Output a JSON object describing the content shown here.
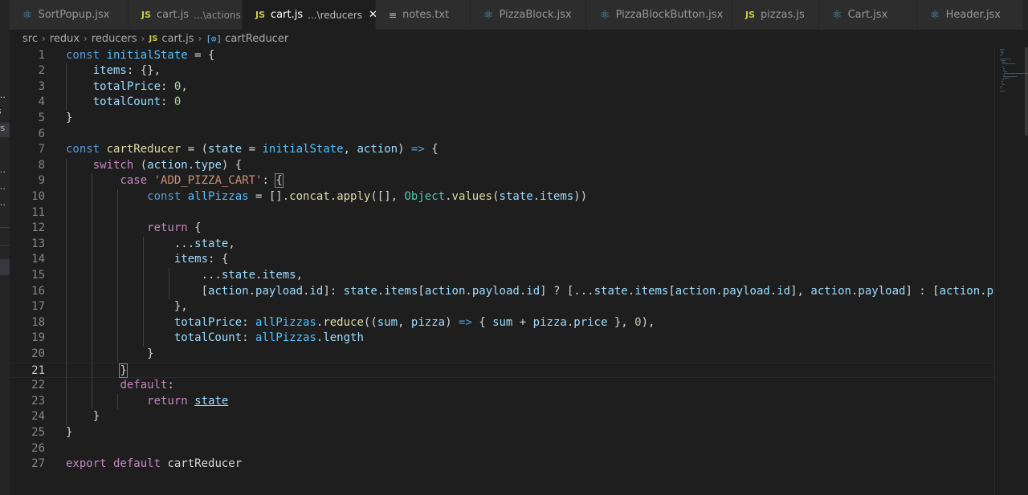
{
  "tabs": [
    {
      "icon": "react",
      "label": "SortPopup.jsx",
      "desc": "",
      "active": false
    },
    {
      "icon": "js",
      "label": "cart.js",
      "desc": "...\\actions",
      "active": false
    },
    {
      "icon": "js",
      "label": "cart.js",
      "desc": "...\\reducers",
      "active": true
    },
    {
      "icon": "txt",
      "label": "notes.txt",
      "desc": "",
      "active": false
    },
    {
      "icon": "react",
      "label": "PizzaBlock.jsx",
      "desc": "",
      "active": false
    },
    {
      "icon": "react",
      "label": "PizzaBlockButton.jsx",
      "desc": "",
      "active": false
    },
    {
      "icon": "js",
      "label": "pizzas.js",
      "desc": "",
      "active": false
    },
    {
      "icon": "react",
      "label": "Cart.jsx",
      "desc": "",
      "active": false
    },
    {
      "icon": "react",
      "label": "Header.jsx",
      "desc": "",
      "active": false
    }
  ],
  "tab_close": "✕",
  "icon_glyphs": {
    "react": "⚛",
    "js": "JS",
    "txt": "≡"
  },
  "breadcrumb": {
    "parts": [
      "src",
      "redux",
      "reducers"
    ],
    "file_icon": "JS",
    "file": "cart.js",
    "symbol_icon": "[⊙]",
    "symbol": "cartReducer"
  },
  "sidebar_fragments": [
    "…",
    "s",
    "rs",
    "…",
    "…",
    "…"
  ],
  "editor": {
    "current_line": 21,
    "lines": [
      [
        [
          "kw",
          "const "
        ],
        [
          "cn",
          "initialState"
        ],
        [
          "pn",
          " = {"
        ]
      ],
      [
        [
          "pn",
          "    "
        ],
        [
          "vr",
          "items"
        ],
        [
          "pn",
          ": {},"
        ]
      ],
      [
        [
          "pn",
          "    "
        ],
        [
          "vr",
          "totalPrice"
        ],
        [
          "pn",
          ": "
        ],
        [
          "nm",
          "0"
        ],
        [
          "pn",
          ","
        ]
      ],
      [
        [
          "pn",
          "    "
        ],
        [
          "vr",
          "totalCount"
        ],
        [
          "pn",
          ": "
        ],
        [
          "nm",
          "0"
        ]
      ],
      [
        [
          "pn",
          "}"
        ]
      ],
      [],
      [
        [
          "kw",
          "const "
        ],
        [
          "fn",
          "cartReducer"
        ],
        [
          "pn",
          " = ("
        ],
        [
          "vr",
          "state"
        ],
        [
          "pn",
          " = "
        ],
        [
          "cn",
          "initialState"
        ],
        [
          "pn",
          ", "
        ],
        [
          "vr",
          "action"
        ],
        [
          "pn",
          ") "
        ],
        [
          "kw",
          "=>"
        ],
        [
          "pn",
          " {"
        ]
      ],
      [
        [
          "pn",
          "    "
        ],
        [
          "ctl",
          "switch"
        ],
        [
          "pn",
          " ("
        ],
        [
          "vr",
          "action"
        ],
        [
          "pn",
          "."
        ],
        [
          "vr",
          "type"
        ],
        [
          "pn",
          ") {"
        ]
      ],
      [
        [
          "pn",
          "        "
        ],
        [
          "ctl",
          "case "
        ],
        [
          "st",
          "'ADD_PIZZA_CART'"
        ],
        [
          "pn",
          ": "
        ],
        [
          "bm",
          "{"
        ]
      ],
      [
        [
          "pn",
          "            "
        ],
        [
          "kw",
          "const "
        ],
        [
          "cn",
          "allPizzas"
        ],
        [
          "pn",
          " = []."
        ],
        [
          "fn",
          "concat"
        ],
        [
          "pn",
          "."
        ],
        [
          "fn",
          "apply"
        ],
        [
          "pn",
          "([], "
        ],
        [
          "cls",
          "Object"
        ],
        [
          "pn",
          "."
        ],
        [
          "fn",
          "values"
        ],
        [
          "pn",
          "("
        ],
        [
          "vr",
          "state"
        ],
        [
          "pn",
          "."
        ],
        [
          "vr",
          "items"
        ],
        [
          "pn",
          "))"
        ]
      ],
      [],
      [
        [
          "pn",
          "            "
        ],
        [
          "ctl",
          "return"
        ],
        [
          "pn",
          " {"
        ]
      ],
      [
        [
          "pn",
          "                ..."
        ],
        [
          "vr",
          "state"
        ],
        [
          "pn",
          ","
        ]
      ],
      [
        [
          "pn",
          "                "
        ],
        [
          "vr",
          "items"
        ],
        [
          "pn",
          ": {"
        ]
      ],
      [
        [
          "pn",
          "                    ..."
        ],
        [
          "vr",
          "state"
        ],
        [
          "pn",
          "."
        ],
        [
          "vr",
          "items"
        ],
        [
          "pn",
          ","
        ]
      ],
      [
        [
          "pn",
          "                    ["
        ],
        [
          "vr",
          "action"
        ],
        [
          "pn",
          "."
        ],
        [
          "vr",
          "payload"
        ],
        [
          "pn",
          "."
        ],
        [
          "vr",
          "id"
        ],
        [
          "pn",
          "]: "
        ],
        [
          "vr",
          "state"
        ],
        [
          "pn",
          "."
        ],
        [
          "vr",
          "items"
        ],
        [
          "pn",
          "["
        ],
        [
          "vr",
          "action"
        ],
        [
          "pn",
          "."
        ],
        [
          "vr",
          "payload"
        ],
        [
          "pn",
          "."
        ],
        [
          "vr",
          "id"
        ],
        [
          "pn",
          "] ? [..."
        ],
        [
          "vr",
          "state"
        ],
        [
          "pn",
          "."
        ],
        [
          "vr",
          "items"
        ],
        [
          "pn",
          "["
        ],
        [
          "vr",
          "action"
        ],
        [
          "pn",
          "."
        ],
        [
          "vr",
          "payload"
        ],
        [
          "pn",
          "."
        ],
        [
          "vr",
          "id"
        ],
        [
          "pn",
          "], "
        ],
        [
          "vr",
          "action"
        ],
        [
          "pn",
          "."
        ],
        [
          "vr",
          "payload"
        ],
        [
          "pn",
          "] : ["
        ],
        [
          "vr",
          "action"
        ],
        [
          "pn",
          "."
        ],
        [
          "vr",
          "payload"
        ],
        [
          "pn",
          "]"
        ]
      ],
      [
        [
          "pn",
          "                },"
        ]
      ],
      [
        [
          "pn",
          "                "
        ],
        [
          "vr",
          "totalPrice"
        ],
        [
          "pn",
          ": "
        ],
        [
          "cn",
          "allPizzas"
        ],
        [
          "pn",
          "."
        ],
        [
          "fn",
          "reduce"
        ],
        [
          "pn",
          "(("
        ],
        [
          "vr",
          "sum"
        ],
        [
          "pn",
          ", "
        ],
        [
          "vr",
          "pizza"
        ],
        [
          "pn",
          ") "
        ],
        [
          "kw",
          "=>"
        ],
        [
          "pn",
          " { "
        ],
        [
          "vr",
          "sum"
        ],
        [
          "pn",
          " + "
        ],
        [
          "vr",
          "pizza"
        ],
        [
          "pn",
          "."
        ],
        [
          "vr",
          "price"
        ],
        [
          "pn",
          " }, "
        ],
        [
          "nm",
          "0"
        ],
        [
          "pn",
          "),"
        ]
      ],
      [
        [
          "pn",
          "                "
        ],
        [
          "vr",
          "totalCount"
        ],
        [
          "pn",
          ": "
        ],
        [
          "cn",
          "allPizzas"
        ],
        [
          "pn",
          "."
        ],
        [
          "vr",
          "length"
        ]
      ],
      [
        [
          "pn",
          "            }"
        ]
      ],
      [
        [
          "pn",
          "        "
        ],
        [
          "bm",
          "}"
        ]
      ],
      [
        [
          "pn",
          "        "
        ],
        [
          "ctl",
          "default"
        ],
        [
          "pn",
          ":"
        ]
      ],
      [
        [
          "pn",
          "            "
        ],
        [
          "ctl",
          "return "
        ],
        [
          "ulvr",
          "state"
        ]
      ],
      [
        [
          "pn",
          "    }"
        ]
      ],
      [
        [
          "pn",
          "}"
        ]
      ],
      [],
      [
        [
          "ctl",
          "export default "
        ],
        [
          "pn",
          "cartReducer"
        ]
      ]
    ]
  },
  "colors": {
    "editor_bg": "#1e1e1e",
    "tab_inactive": "#2d2d2d",
    "keyword": "#569cd6",
    "control": "#c586c0",
    "string": "#ce9178",
    "function": "#dcdcaa",
    "variable": "#9cdcfe"
  }
}
